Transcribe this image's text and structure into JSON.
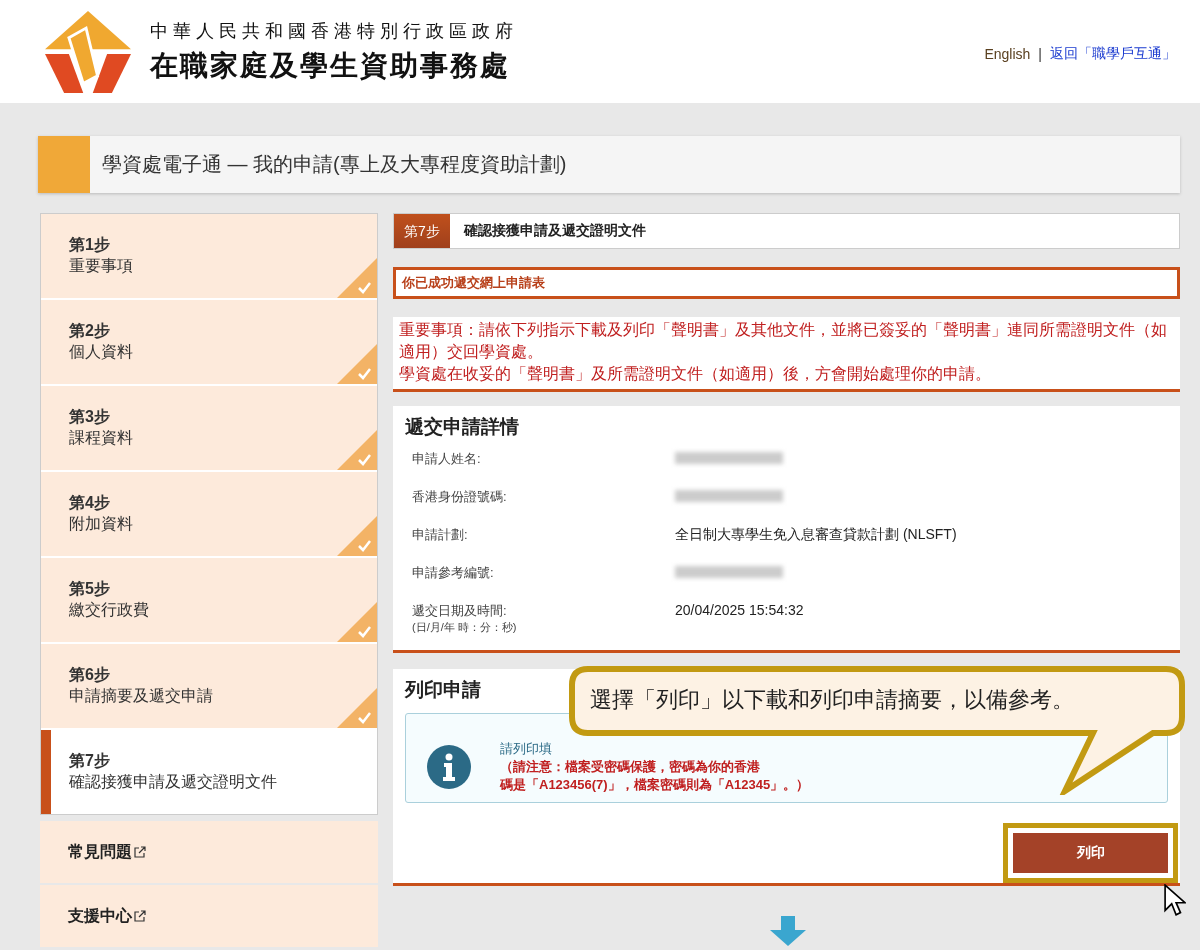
{
  "header": {
    "gov_name": "中華人民共和國香港特別行政區政府",
    "agency_name": "在職家庭及學生資助事務處",
    "separator": "|",
    "links": [
      {
        "label": "English",
        "kind": "plain"
      },
      {
        "label": "返回「職學戶互通」",
        "kind": "link"
      }
    ]
  },
  "page_title": "學資處電子通 — 我的申請(專上及大專程度資助計劃)",
  "steps": [
    {
      "step": "第1步",
      "title": "重要事項",
      "completed": true,
      "selected": false
    },
    {
      "step": "第2步",
      "title": "個人資料",
      "completed": true,
      "selected": false
    },
    {
      "step": "第3步",
      "title": "課程資料",
      "completed": true,
      "selected": false
    },
    {
      "step": "第4步",
      "title": "附加資料",
      "completed": true,
      "selected": false
    },
    {
      "step": "第5步",
      "title": "繳交行政費",
      "completed": true,
      "selected": false
    },
    {
      "step": "第6步",
      "title": "申請摘要及遞交申請",
      "completed": true,
      "selected": false
    },
    {
      "step": "第7步",
      "title": "確認接獲申請及遞交證明文件",
      "completed": false,
      "selected": true
    }
  ],
  "side_links": [
    "常見問題",
    "支援中心"
  ],
  "step_header": {
    "badge": "第7步",
    "title": "確認接獲申請及遞交證明文件"
  },
  "success_message": "你已成功遞交網上申請表",
  "notice_lines": [
    "重要事項：請依下列指示下載及列印「聲明書」及其他文件，並將已簽妥的「聲明書」連同所需證明文件（如適用）交回學資處。",
    "學資處在收妥的「聲明書」及所需證明文件（如適用）後，方會開始處理你的申請。"
  ],
  "details": {
    "title": "遞交申請詳情",
    "rows": [
      {
        "label": "申請人姓名:",
        "kind": "redacted"
      },
      {
        "label": "香港身份證號碼:",
        "kind": "redacted"
      },
      {
        "label": "申請計劃:",
        "kind": "text",
        "value": "全日制大專學生免入息審查貸款計劃 (NLSFT)"
      },
      {
        "label": "申請參考編號:",
        "kind": "redacted"
      },
      {
        "label": "遞交日期及時間:",
        "note": "(日/月/年 時：分：秒)",
        "kind": "text",
        "value": "20/04/2025 15:54:32"
      }
    ]
  },
  "print_section": {
    "title": "列印申請",
    "info_line": "請列印填",
    "warning_lines": [
      "（請注意：檔案受密碼保護，密碼為你的香港",
      "碼是「A123456(7)」，檔案密碼則為「A12345」。）"
    ],
    "button": "列印"
  },
  "callout": "選擇「列印」以下載和列印申請摘要，以備參考。"
}
